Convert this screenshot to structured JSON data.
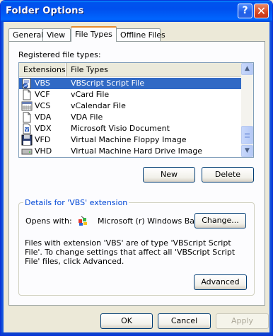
{
  "window": {
    "title": "Folder Options",
    "help_glyph": "?",
    "close_glyph": "✕"
  },
  "tabs": [
    {
      "label": "General"
    },
    {
      "label": "View"
    },
    {
      "label": "File Types"
    },
    {
      "label": "Offline Files"
    }
  ],
  "file_types": {
    "label": "Registered file types:",
    "columns": [
      "Extensions",
      "File Types"
    ],
    "rows": [
      {
        "ext": "VBS",
        "type": "VBScript Script File",
        "icon": "vbs-script-icon",
        "selected": true
      },
      {
        "ext": "VCF",
        "type": "vCard File",
        "icon": "document-icon"
      },
      {
        "ext": "VCS",
        "type": "vCalendar File",
        "icon": "calendar-icon"
      },
      {
        "ext": "VDA",
        "type": "VDA File",
        "icon": "document-icon"
      },
      {
        "ext": "VDX",
        "type": "Microsoft Visio Document",
        "icon": "visio-icon"
      },
      {
        "ext": "VFD",
        "type": "Virtual Machine Floppy Image",
        "icon": "floppy-icon"
      },
      {
        "ext": "VHD",
        "type": "Virtual Machine Hard Drive Image",
        "icon": "hard-drive-icon"
      }
    ],
    "scroll_up_glyph": "▲",
    "scroll_down_glyph": "▼",
    "new_label": "New",
    "delete_label": "Delete"
  },
  "details": {
    "legend": "Details for 'VBS' extension",
    "opens_with_label": "Opens with:",
    "opens_with_value": "Microsoft (r) Windows Base",
    "change_label": "Change...",
    "description": "Files with extension 'VBS' are of type 'VBScript Script File'.  To change settings that affect all 'VBScript Script File' files, click Advanced.",
    "advanced_label": "Advanced"
  },
  "footer": {
    "ok_label": "OK",
    "cancel_label": "Cancel",
    "apply_label": "Apply"
  }
}
